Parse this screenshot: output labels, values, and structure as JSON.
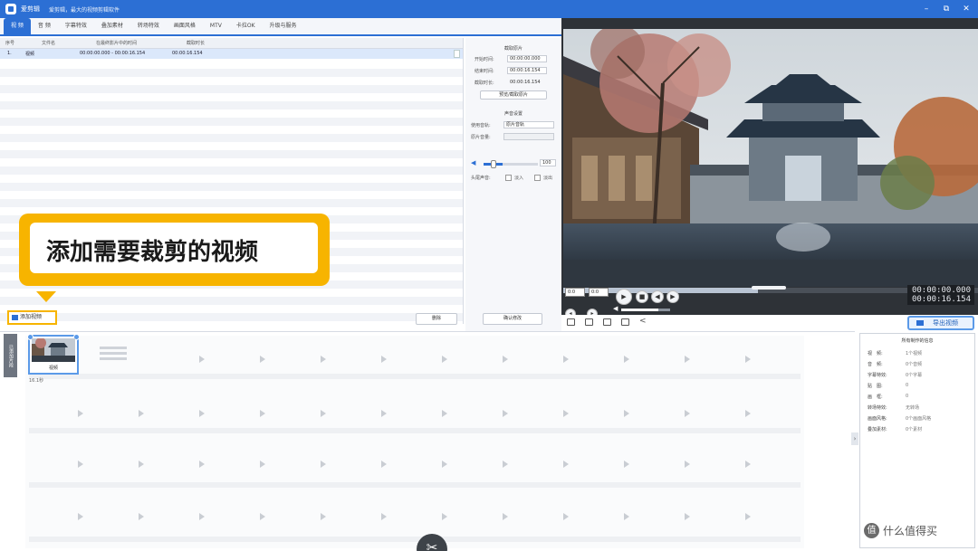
{
  "titlebar": {
    "app_name": "爱剪辑",
    "subtitle": "爱剪辑，最大的视频剪辑软件",
    "minimize": "–",
    "restore": "⧉",
    "close": "✕"
  },
  "tabs": [
    {
      "label": "视 频"
    },
    {
      "label": "音 频"
    },
    {
      "label": "字幕特效"
    },
    {
      "label": "叠加素材"
    },
    {
      "label": "转场特效"
    },
    {
      "label": "画面风格"
    },
    {
      "label": "MTV"
    },
    {
      "label": "卡拉OK"
    },
    {
      "label": "升级与服务"
    }
  ],
  "file_list": {
    "columns": [
      "序号",
      "文件名",
      "在最终影片中的时间",
      "截取时长"
    ],
    "rows": [
      {
        "index": "1.",
        "name": "视频",
        "time": "00:00:00.000 - 00:00:16.154",
        "duration": "00:00:16.154"
      }
    ]
  },
  "properties": {
    "clip_title": "截取原片",
    "start_label": "开始时间:",
    "start_value": "00:00:00.000",
    "end_label": "结束时间:",
    "end_value": "00:00:16.154",
    "length_label": "截取时长:",
    "length_value": "00:00:16.154",
    "pick_btn": "预览/截取原片",
    "audio_title": "声音设置",
    "track_label": "使用音轨:",
    "track_value": "原片音轨",
    "speed_label": "原片音量:",
    "volume_value": "100",
    "volume_level": 0.35,
    "fade_label": "头尾声音:",
    "fade_in": "淡入",
    "fade_out": "淡出"
  },
  "callout": {
    "text": "添加需要裁剪的视频"
  },
  "buttons": {
    "add_video": "添加视频",
    "delete": "删除",
    "confirm": "确认修改",
    "export": "导出视频"
  },
  "preview": {
    "progress": 0.47,
    "time_current": "00:00:00.000",
    "time_total": "00:00:16.154",
    "time_input_a": "0:0",
    "time_input_b": "0:0",
    "volume_level": 0.75
  },
  "timeline": {
    "sidebar_label": "已添加片段",
    "clip_label": "视频",
    "clip_duration": "16.1秒"
  },
  "summary": {
    "title": "所有制作的信息",
    "items": [
      {
        "label": "视　频:",
        "value": "1个视频"
      },
      {
        "label": "音　频:",
        "value": "0个音频"
      },
      {
        "label": "字幕特效:",
        "value": "0个字幕"
      },
      {
        "label": "贴　图:",
        "value": "0"
      },
      {
        "label": "画　框:",
        "value": "0"
      },
      {
        "label": "转场特效:",
        "value": "无转场"
      },
      {
        "label": "画面风格:",
        "value": "0个画面风格"
      },
      {
        "label": "叠加素材:",
        "value": "0个素材"
      }
    ]
  },
  "watermark": {
    "icon": "值",
    "text": "什么值得买"
  },
  "colors": {
    "accent": "#2c6fd4",
    "highlight": "#f7b400",
    "preview_bg": "#2e3237"
  }
}
